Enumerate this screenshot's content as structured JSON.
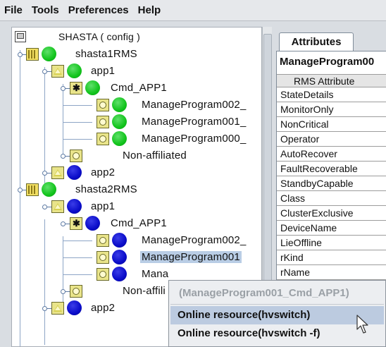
{
  "menubar": {
    "items": [
      "File",
      "Tools",
      "Preferences",
      "Help"
    ]
  },
  "tree": {
    "root": "SHASTA ( config )",
    "nodes": [
      "shasta1RMS",
      "app1",
      "Cmd_APP1",
      "ManageProgram002_",
      "ManageProgram001_",
      "ManageProgram000_",
      "Non-affiliated",
      "app2",
      "shasta2RMS",
      "app1",
      "Cmd_APP1",
      "ManageProgram002_",
      "ManageProgram001",
      "Mana",
      "Non-affili",
      "app2"
    ]
  },
  "attributes": {
    "tab_label": "Attributes",
    "resource_name": "ManageProgram00",
    "column_header": "RMS Attribute",
    "rows": [
      "StateDetails",
      "MonitorOnly",
      "NonCritical",
      "Operator",
      "AutoRecover",
      "FaultRecoverable",
      "StandbyCapable",
      "Class",
      "ClusterExclusive",
      "DeviceName",
      "LieOffline",
      "rKind",
      "rName"
    ]
  },
  "context_menu": {
    "title": "(ManageProgram001_Cmd_APP1)",
    "items": [
      "Online resource(hvswitch)",
      "Online resource(hvswitch -f)"
    ]
  },
  "colors": {
    "online": "#12c41c",
    "offline": "#0a0cc9",
    "selection": "#b9cde5"
  }
}
